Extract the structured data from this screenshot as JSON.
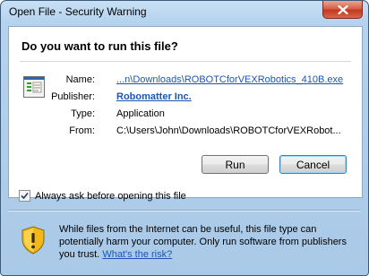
{
  "window": {
    "title": "Open File - Security Warning"
  },
  "dialog": {
    "question": "Do you want to run this file?",
    "fields": {
      "name_label": "Name:",
      "name_value": "...n\\Downloads\\ROBOTCforVEXRobotics_410B.exe",
      "publisher_label": "Publisher:",
      "publisher_value": "Robomatter Inc.",
      "type_label": "Type:",
      "type_value": "Application",
      "from_label": "From:",
      "from_value": "C:\\Users\\John\\Downloads\\ROBOTCforVEXRobot..."
    },
    "buttons": {
      "run": "Run",
      "cancel": "Cancel"
    },
    "checkbox": {
      "label": "Always ask before opening this file",
      "checked": true
    },
    "warning": {
      "text": "While files from the Internet can be useful, this file type can potentially harm your computer. Only run software from publishers you trust.",
      "link": "What's the risk?"
    }
  },
  "colors": {
    "link": "#1a56b8",
    "frame": "#a9c9e8",
    "close_button": "#c2391f"
  },
  "icons": [
    "close-icon",
    "application-file-icon",
    "checkmark-icon",
    "security-shield-icon"
  ]
}
